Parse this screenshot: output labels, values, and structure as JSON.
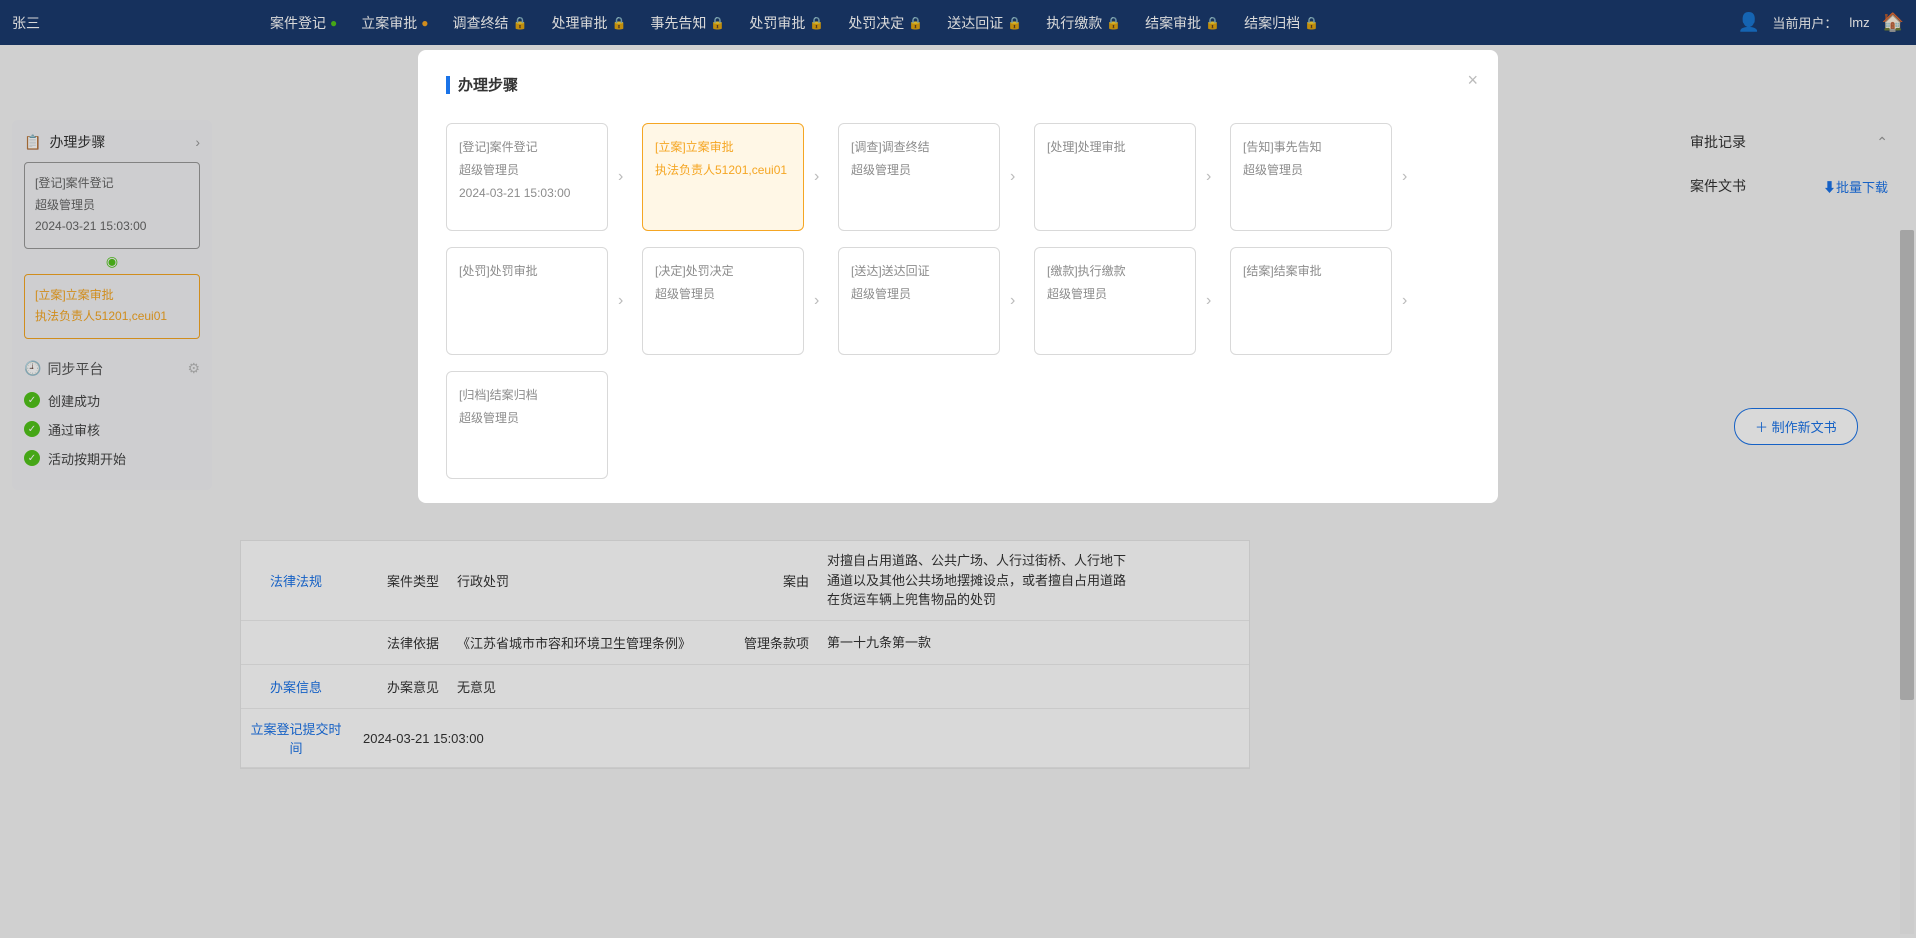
{
  "header": {
    "user_name": "张三",
    "tabs": [
      {
        "label": "案件登记",
        "icon": "check-circle-icon",
        "color": "#52c41a"
      },
      {
        "label": "立案审批",
        "icon": "warning-circle-icon",
        "color": "#f5a623"
      },
      {
        "label": "调查终结",
        "icon": "lock-icon",
        "color": "#bbb"
      },
      {
        "label": "处理审批",
        "icon": "lock-icon",
        "color": "#bbb"
      },
      {
        "label": "事先告知",
        "icon": "lock-icon",
        "color": "#bbb"
      },
      {
        "label": "处罚审批",
        "icon": "lock-icon",
        "color": "#bbb"
      },
      {
        "label": "处罚决定",
        "icon": "lock-icon",
        "color": "#bbb"
      },
      {
        "label": "送达回证",
        "icon": "lock-icon",
        "color": "#bbb"
      },
      {
        "label": "执行缴款",
        "icon": "lock-icon",
        "color": "#bbb"
      },
      {
        "label": "结案审批",
        "icon": "lock-icon",
        "color": "#bbb"
      },
      {
        "label": "结案归档",
        "icon": "lock-icon",
        "color": "#bbb"
      }
    ],
    "current_user_label": "当前用户：",
    "current_user_value": "lmz"
  },
  "sidebar": {
    "steps_title": "办理步骤",
    "step1": {
      "title": "[登记]案件登记",
      "user": "超级管理员",
      "time": "2024-03-21 15:03:00"
    },
    "step2": {
      "title": "[立案]立案审批",
      "user": "执法负责人51201,ceui01"
    },
    "sync_title": "同步平台",
    "status1": "创建成功",
    "status2": "通过审核",
    "status3": "活动按期开始"
  },
  "right": {
    "item1": "审批记录",
    "item2": "案件文书",
    "batch_download": "⬇批量下载",
    "make_doc_button": "＋ 制作新文书"
  },
  "main": {
    "row1": {
      "side": "法律法规",
      "label1": "案件类型",
      "value1": "行政处罚",
      "label2": "案由",
      "value2": "对擅自占用道路、公共广场、人行过街桥、人行地下通道以及其他公共场地摆摊设点，或者擅自占用道路在货运车辆上兜售物品的处罚"
    },
    "row2": {
      "label1": "法律依据",
      "value1": "《江苏省城市市容和环境卫生管理条例》",
      "label2": "管理条款项",
      "value2": "第一十九条第一款"
    },
    "row3": {
      "side": "办案信息",
      "label1": "办案意见",
      "value1": "无意见"
    },
    "row4": {
      "side": "立案登记提交时间",
      "value1": "2024-03-21 15:03:00"
    }
  },
  "modal": {
    "title": "办理步骤",
    "steps": [
      {
        "title": "[登记]案件登记",
        "user": "超级管理员",
        "time": "2024-03-21 15:03:00",
        "state": "done"
      },
      {
        "title": "[立案]立案审批",
        "user": "执法负责人51201,ceui01",
        "time": "",
        "state": "current"
      },
      {
        "title": "[调查]调查终结",
        "user": "超级管理员",
        "time": "",
        "state": "pending"
      },
      {
        "title": "[处理]处理审批",
        "user": "",
        "time": "",
        "state": "pending"
      },
      {
        "title": "[告知]事先告知",
        "user": "超级管理员",
        "time": "",
        "state": "pending"
      },
      {
        "title": "[处罚]处罚审批",
        "user": "",
        "time": "",
        "state": "pending"
      },
      {
        "title": "[决定]处罚决定",
        "user": "超级管理员",
        "time": "",
        "state": "pending"
      },
      {
        "title": "[送达]送达回证",
        "user": "超级管理员",
        "time": "",
        "state": "pending"
      },
      {
        "title": "[缴款]执行缴款",
        "user": "超级管理员",
        "time": "",
        "state": "pending"
      },
      {
        "title": "[结案]结案审批",
        "user": "",
        "time": "",
        "state": "pending"
      },
      {
        "title": "[归档]结案归档",
        "user": "超级管理员",
        "time": "",
        "state": "pending"
      }
    ]
  }
}
